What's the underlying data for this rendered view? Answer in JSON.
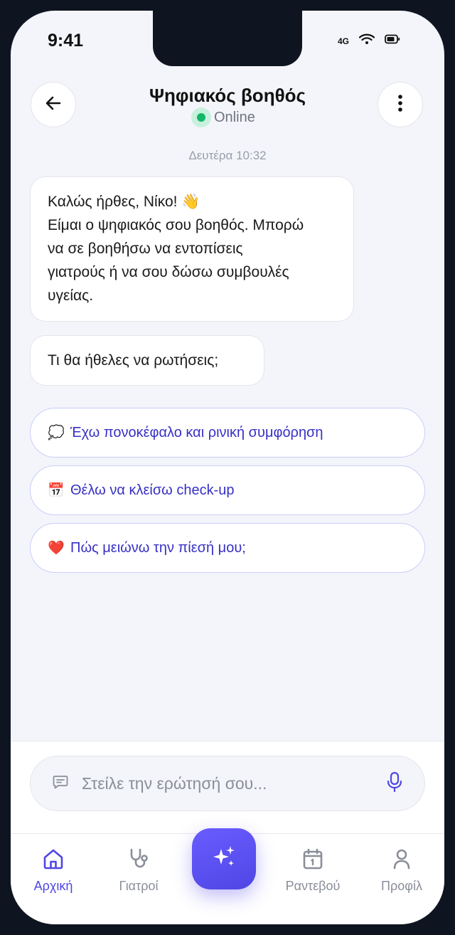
{
  "status_bar": {
    "time": "9:41",
    "network": "4G"
  },
  "header": {
    "title": "Ψηφιακός βοηθός",
    "status": "Online"
  },
  "chat": {
    "timestamp": "Δευτέρα 10:32",
    "messages": [
      {
        "lines": [
          "Καλώς ήρθες, Νίκο! 👋",
          "Είμαι ο ψηφιακός σου βοηθός. Μπορώ",
          "να σε βοηθήσω να εντοπίσεις",
          "γιατρούς ή να σου δώσω συμβουλές",
          "υγείας."
        ]
      },
      {
        "text": "Τι θα ήθελες να ρωτήσεις;"
      }
    ],
    "suggestions": [
      {
        "emoji": "💭",
        "text": "Έχω πονοκέφαλο και ρινική συμφόρηση"
      },
      {
        "emoji": "📅",
        "text": "Θέλω να κλείσω check-up"
      },
      {
        "emoji": "❤️",
        "text": "Πώς μειώνω την πίεσή μου;"
      }
    ]
  },
  "composer": {
    "placeholder": "Στείλε την ερώτησή σου..."
  },
  "tabbar": {
    "home": "Αρχική",
    "doctors": "Γιατροί",
    "appointments": "Ραντεβού",
    "profile": "Προφίλ"
  },
  "colors": {
    "accent": "#4f46e5",
    "online": "#12b76a",
    "background": "#f4f5fa"
  }
}
